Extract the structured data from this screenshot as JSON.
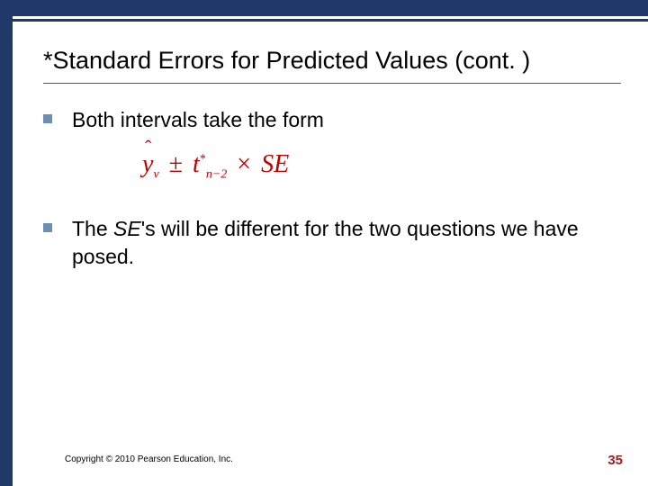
{
  "title": "*Standard Errors for Predicted Values (cont. )",
  "bullets": {
    "b1": "Both intervals take the form",
    "b2_pre": "The ",
    "b2_se": "SE",
    "b2_post": "'s will be different for the two questions we have posed."
  },
  "formula": {
    "yhat": "y",
    "sub_v": "v",
    "pm": "±",
    "t": "t",
    "sub_n": "n−2",
    "star": "*",
    "times": "×",
    "se": "SE"
  },
  "footer": {
    "copyright": "Copyright © 2010 Pearson Education, Inc.",
    "page": "35"
  }
}
